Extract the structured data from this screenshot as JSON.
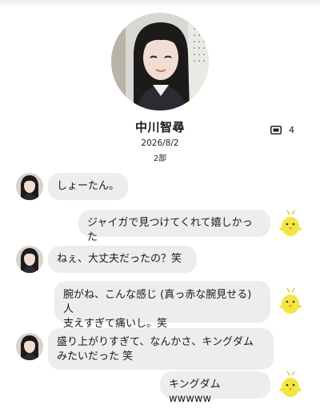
{
  "profile": {
    "name": "中川智尋",
    "date": "2026/8/2",
    "subtitle": "2部",
    "message_count": "4",
    "message_count_icon": "message-box-icon"
  },
  "messages": [
    {
      "sender": "member",
      "text": "しょーたん。"
    },
    {
      "sender": "user",
      "text": "ジャイガで見つけてくれて嬉しかった"
    },
    {
      "sender": "member",
      "text": "ねぇ、大丈夫だったの？笑"
    },
    {
      "sender": "user",
      "text": "腕がね、こんな感じ (真っ赤な腕見せる) 人\n支えすぎて痛いし。笑"
    },
    {
      "sender": "member",
      "text": "盛り上がりすぎて、なんかさ、キングダム\nみたいだった 笑"
    },
    {
      "sender": "user",
      "text": "キングダム wwwww"
    }
  ],
  "colors": {
    "bubble": "#ededed",
    "sticker": "#f2e640"
  },
  "user_sticker_icon": "yellow-chick-sticker-icon"
}
